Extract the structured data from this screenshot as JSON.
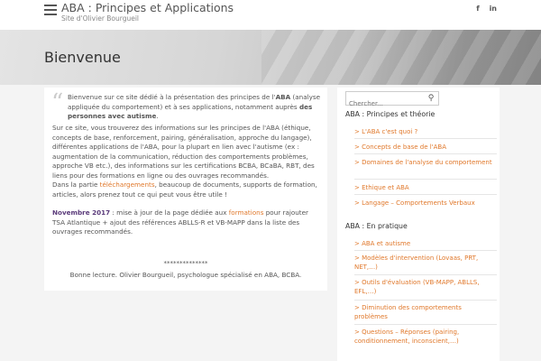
{
  "header": {
    "site_title": "ABA : Principes et Applications",
    "site_description": "Site d'Olivier Bourgueil",
    "social": {
      "facebook": "f",
      "linkedin": "in"
    }
  },
  "banner": {
    "title": "Bienvenue"
  },
  "content": {
    "intro_before": "Bienvenue sur ce site dédié à la présentation des principes de l'",
    "intro_aba": "ABA",
    "intro_middle": " (analyse appliquée du comportement) et à ses applications, notamment auprès ",
    "intro_bold": "des personnes avec autisme",
    "intro_end": ".",
    "para1": "Sur ce site, vous trouverez des informations sur les principes de l'ABA (éthique, concepts de base, renforcement, pairing, généralisation, approche du langage), différentes applications de l'ABA, pour la plupart en lien avec l'autisme (ex : augmentation de la communication, réduction des comportements problèmes, approche VB etc.), des informations sur les certifications BCBA, BCaBA, RBT, des liens pour des formations en ligne ou des ouvrages recommandés.",
    "para2_before": "Dans la partie ",
    "para2_link": "téléchargements",
    "para2_after": ", beaucoup de documents, supports de formation, articles, alors prenez tout ce qui peut vous être utile !",
    "news_date": "Novembre 2017",
    "news_before": " : mise à jour de la page dédiée aux ",
    "news_link": "formations",
    "news_after": " pour rajouter TSA Atlantique + ajout des références ABLLS-R et VB-MAPP dans la liste des ouvrages recommandés.",
    "stars": "**************",
    "signoff": "Bonne lecture. Olivier Bourgueil, psychologue spécialisé en ABA, BCBA."
  },
  "sidebar": {
    "search_placeholder": "Chercher...",
    "widget1_title": "ABA : Principes et théorie",
    "widget1_items": [
      "> L'ABA c'est quoi ?",
      "> Concepts de base de l'ABA",
      "> Domaines de l'analyse du comportement",
      "> Ethique et ABA",
      "> Langage – Comportements Verbaux"
    ],
    "widget2_title": "ABA : En pratique",
    "widget2_items": [
      "> ABA et autisme",
      "> Modèles d'intervention (Lovaas, PRT, NET,…)",
      "> Outils d'évaluation (VB-MAPP, ABLLS, EFL,…)",
      "> Diminution des comportements problèmes",
      "> Questions – Réponses (pairing, conditionnement, inconscient,…)"
    ]
  },
  "colors": {
    "link": "#e0782b",
    "accent_purple": "#5a3a7a"
  }
}
